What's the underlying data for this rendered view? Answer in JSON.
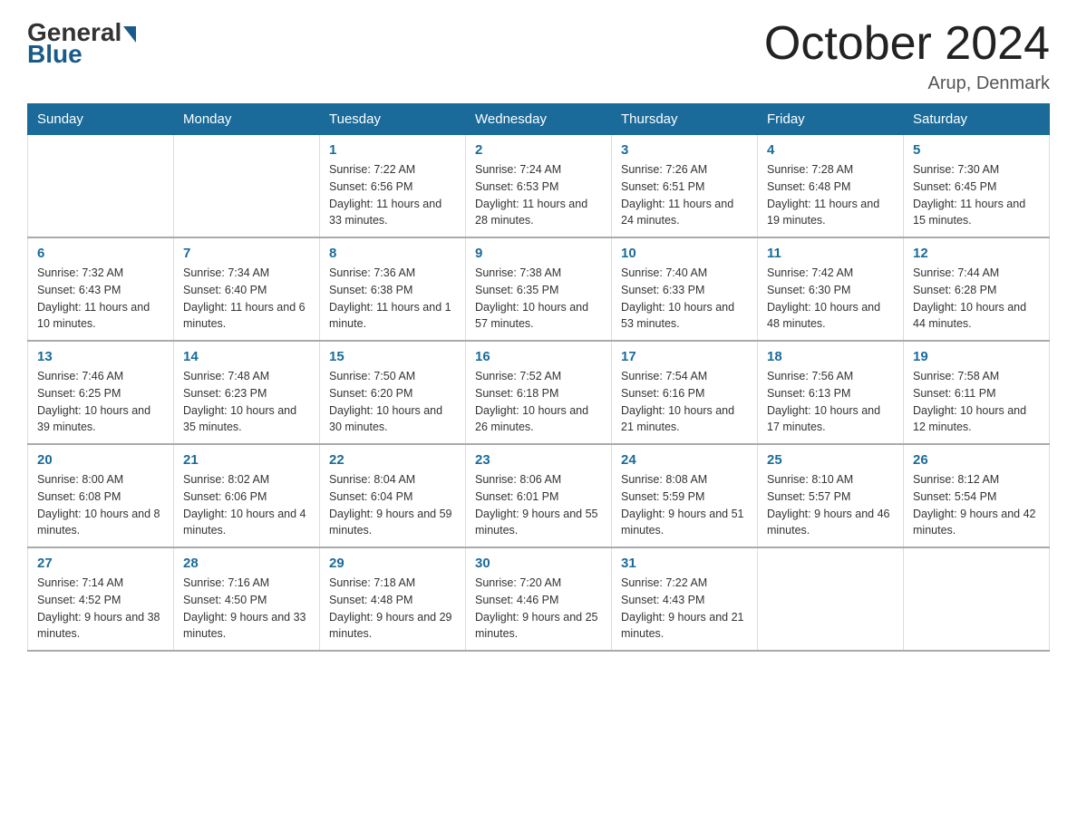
{
  "logo": {
    "general": "General",
    "blue": "Blue"
  },
  "title": "October 2024",
  "location": "Arup, Denmark",
  "days_of_week": [
    "Sunday",
    "Monday",
    "Tuesday",
    "Wednesday",
    "Thursday",
    "Friday",
    "Saturday"
  ],
  "weeks": [
    [
      null,
      null,
      {
        "day": 1,
        "sunrise": "7:22 AM",
        "sunset": "6:56 PM",
        "daylight": "11 hours and 33 minutes."
      },
      {
        "day": 2,
        "sunrise": "7:24 AM",
        "sunset": "6:53 PM",
        "daylight": "11 hours and 28 minutes."
      },
      {
        "day": 3,
        "sunrise": "7:26 AM",
        "sunset": "6:51 PM",
        "daylight": "11 hours and 24 minutes."
      },
      {
        "day": 4,
        "sunrise": "7:28 AM",
        "sunset": "6:48 PM",
        "daylight": "11 hours and 19 minutes."
      },
      {
        "day": 5,
        "sunrise": "7:30 AM",
        "sunset": "6:45 PM",
        "daylight": "11 hours and 15 minutes."
      }
    ],
    [
      {
        "day": 6,
        "sunrise": "7:32 AM",
        "sunset": "6:43 PM",
        "daylight": "11 hours and 10 minutes."
      },
      {
        "day": 7,
        "sunrise": "7:34 AM",
        "sunset": "6:40 PM",
        "daylight": "11 hours and 6 minutes."
      },
      {
        "day": 8,
        "sunrise": "7:36 AM",
        "sunset": "6:38 PM",
        "daylight": "11 hours and 1 minute."
      },
      {
        "day": 9,
        "sunrise": "7:38 AM",
        "sunset": "6:35 PM",
        "daylight": "10 hours and 57 minutes."
      },
      {
        "day": 10,
        "sunrise": "7:40 AM",
        "sunset": "6:33 PM",
        "daylight": "10 hours and 53 minutes."
      },
      {
        "day": 11,
        "sunrise": "7:42 AM",
        "sunset": "6:30 PM",
        "daylight": "10 hours and 48 minutes."
      },
      {
        "day": 12,
        "sunrise": "7:44 AM",
        "sunset": "6:28 PM",
        "daylight": "10 hours and 44 minutes."
      }
    ],
    [
      {
        "day": 13,
        "sunrise": "7:46 AM",
        "sunset": "6:25 PM",
        "daylight": "10 hours and 39 minutes."
      },
      {
        "day": 14,
        "sunrise": "7:48 AM",
        "sunset": "6:23 PM",
        "daylight": "10 hours and 35 minutes."
      },
      {
        "day": 15,
        "sunrise": "7:50 AM",
        "sunset": "6:20 PM",
        "daylight": "10 hours and 30 minutes."
      },
      {
        "day": 16,
        "sunrise": "7:52 AM",
        "sunset": "6:18 PM",
        "daylight": "10 hours and 26 minutes."
      },
      {
        "day": 17,
        "sunrise": "7:54 AM",
        "sunset": "6:16 PM",
        "daylight": "10 hours and 21 minutes."
      },
      {
        "day": 18,
        "sunrise": "7:56 AM",
        "sunset": "6:13 PM",
        "daylight": "10 hours and 17 minutes."
      },
      {
        "day": 19,
        "sunrise": "7:58 AM",
        "sunset": "6:11 PM",
        "daylight": "10 hours and 12 minutes."
      }
    ],
    [
      {
        "day": 20,
        "sunrise": "8:00 AM",
        "sunset": "6:08 PM",
        "daylight": "10 hours and 8 minutes."
      },
      {
        "day": 21,
        "sunrise": "8:02 AM",
        "sunset": "6:06 PM",
        "daylight": "10 hours and 4 minutes."
      },
      {
        "day": 22,
        "sunrise": "8:04 AM",
        "sunset": "6:04 PM",
        "daylight": "9 hours and 59 minutes."
      },
      {
        "day": 23,
        "sunrise": "8:06 AM",
        "sunset": "6:01 PM",
        "daylight": "9 hours and 55 minutes."
      },
      {
        "day": 24,
        "sunrise": "8:08 AM",
        "sunset": "5:59 PM",
        "daylight": "9 hours and 51 minutes."
      },
      {
        "day": 25,
        "sunrise": "8:10 AM",
        "sunset": "5:57 PM",
        "daylight": "9 hours and 46 minutes."
      },
      {
        "day": 26,
        "sunrise": "8:12 AM",
        "sunset": "5:54 PM",
        "daylight": "9 hours and 42 minutes."
      }
    ],
    [
      {
        "day": 27,
        "sunrise": "7:14 AM",
        "sunset": "4:52 PM",
        "daylight": "9 hours and 38 minutes."
      },
      {
        "day": 28,
        "sunrise": "7:16 AM",
        "sunset": "4:50 PM",
        "daylight": "9 hours and 33 minutes."
      },
      {
        "day": 29,
        "sunrise": "7:18 AM",
        "sunset": "4:48 PM",
        "daylight": "9 hours and 29 minutes."
      },
      {
        "day": 30,
        "sunrise": "7:20 AM",
        "sunset": "4:46 PM",
        "daylight": "9 hours and 25 minutes."
      },
      {
        "day": 31,
        "sunrise": "7:22 AM",
        "sunset": "4:43 PM",
        "daylight": "9 hours and 21 minutes."
      },
      null,
      null
    ]
  ]
}
